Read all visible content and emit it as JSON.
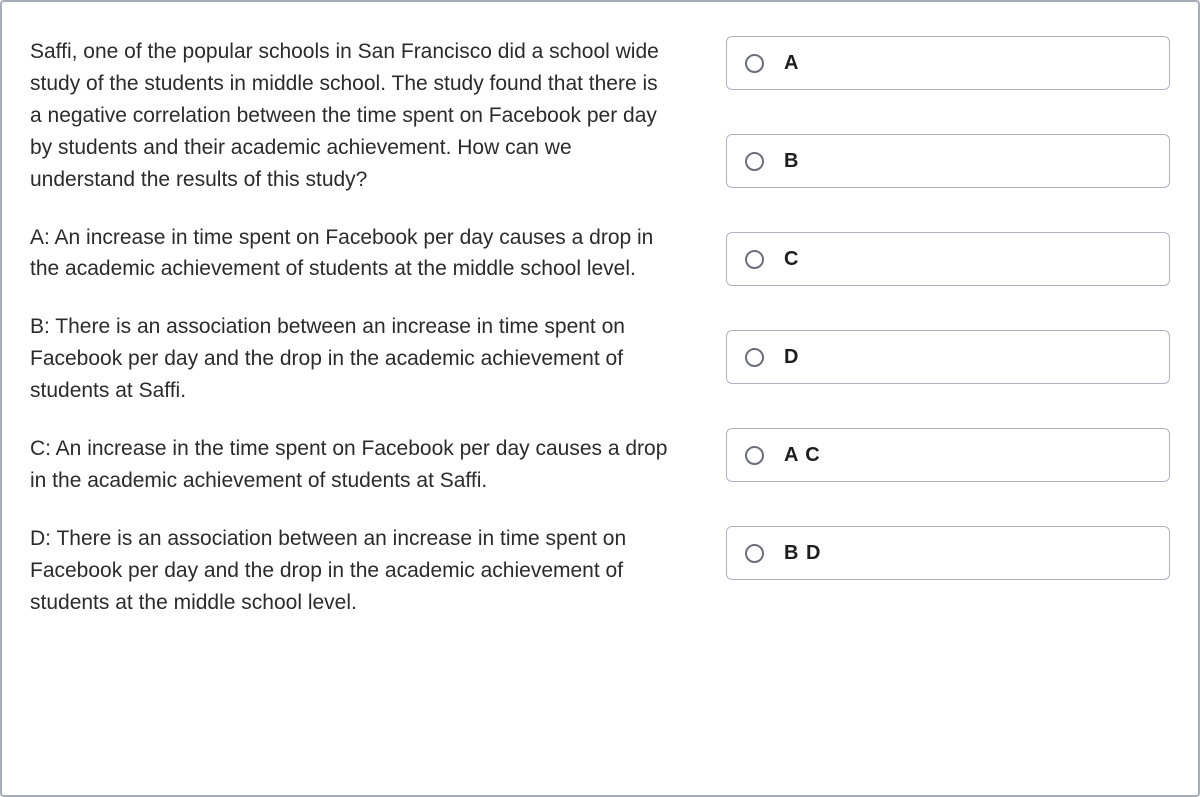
{
  "question": {
    "prompt": "Saffi, one of the popular schools in San Francisco did a school wide study of the students in middle school. The study found that there is a negative correlation between the time spent on Facebook per day by students and their academic achievement. How can we understand the results of this study?",
    "statements": {
      "A": "A: An increase in time spent on Facebook per day causes a drop in the academic achievement of students at the middle school level.",
      "B": "B: There is an association between an increase in time spent on Facebook per day and the drop in the academic achievement of students at Saffi.",
      "C": "C: An increase in the time spent on Facebook per day causes a drop in the academic achievement of students at Saffi.",
      "D": "D: There is an association between an increase in time spent on Facebook per day and the drop in the academic achievement of students at the middle school level."
    }
  },
  "choices": [
    {
      "label": "A"
    },
    {
      "label": "B"
    },
    {
      "label": "C"
    },
    {
      "label": "D"
    },
    {
      "label": "A C"
    },
    {
      "label": "B D"
    }
  ]
}
